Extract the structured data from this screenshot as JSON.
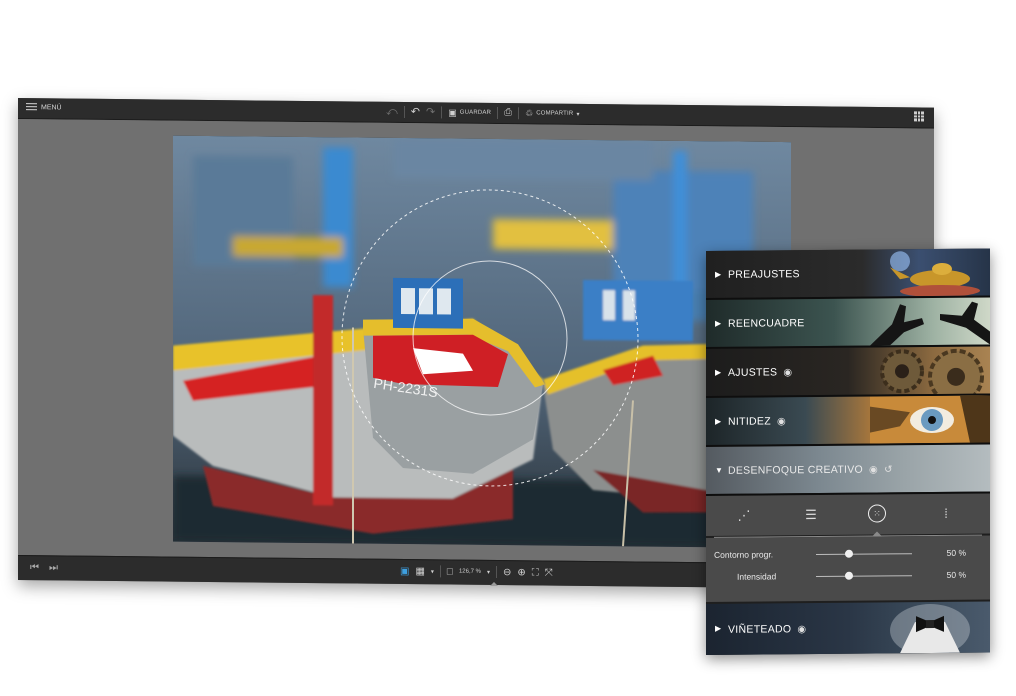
{
  "topbar": {
    "menu_label": "MENÚ",
    "save_label": "GUARDAR",
    "share_label": "COMPARTIR",
    "share_caret": "▾"
  },
  "bottombar": {
    "zoom_label": "126,7 %",
    "zoom_caret": "▾"
  },
  "panel": {
    "sections": [
      {
        "label": "PREAJUSTES"
      },
      {
        "label": "REENCUADRE"
      },
      {
        "label": "AJUSTES"
      },
      {
        "label": "NITIDEZ"
      },
      {
        "label": "DESENFOQUE CREATIVO"
      },
      {
        "label": "VIÑETEADO"
      }
    ],
    "sliders": [
      {
        "label": "Contorno progr.",
        "value": "50 %",
        "level": 0.5
      },
      {
        "label": "Intensidad",
        "value": "50 %",
        "level": 0.5
      }
    ]
  },
  "colors": {
    "accent": "#3ea0e0",
    "toolbar_bg": "#2c2c2c",
    "canvas_bg": "#707070",
    "panel_bg": "#1f1f1f",
    "tools_bg": "#4a4a4a"
  },
  "icons": [
    "hamburger-icon",
    "undo-all-icon",
    "undo-icon",
    "redo-icon",
    "save-icon",
    "print-icon",
    "share-icon",
    "grid-view-icon",
    "first-image-icon",
    "last-image-icon",
    "single-view-icon",
    "compare-view-icon",
    "fit-icon",
    "zoom-out-icon",
    "zoom-in-icon",
    "fit-screen-icon",
    "actual-size-icon",
    "eye-icon",
    "reset-icon",
    "tilt-shift-linear-icon",
    "tilt-shift-band-icon",
    "radial-blur-icon",
    "dots-blur-icon"
  ]
}
